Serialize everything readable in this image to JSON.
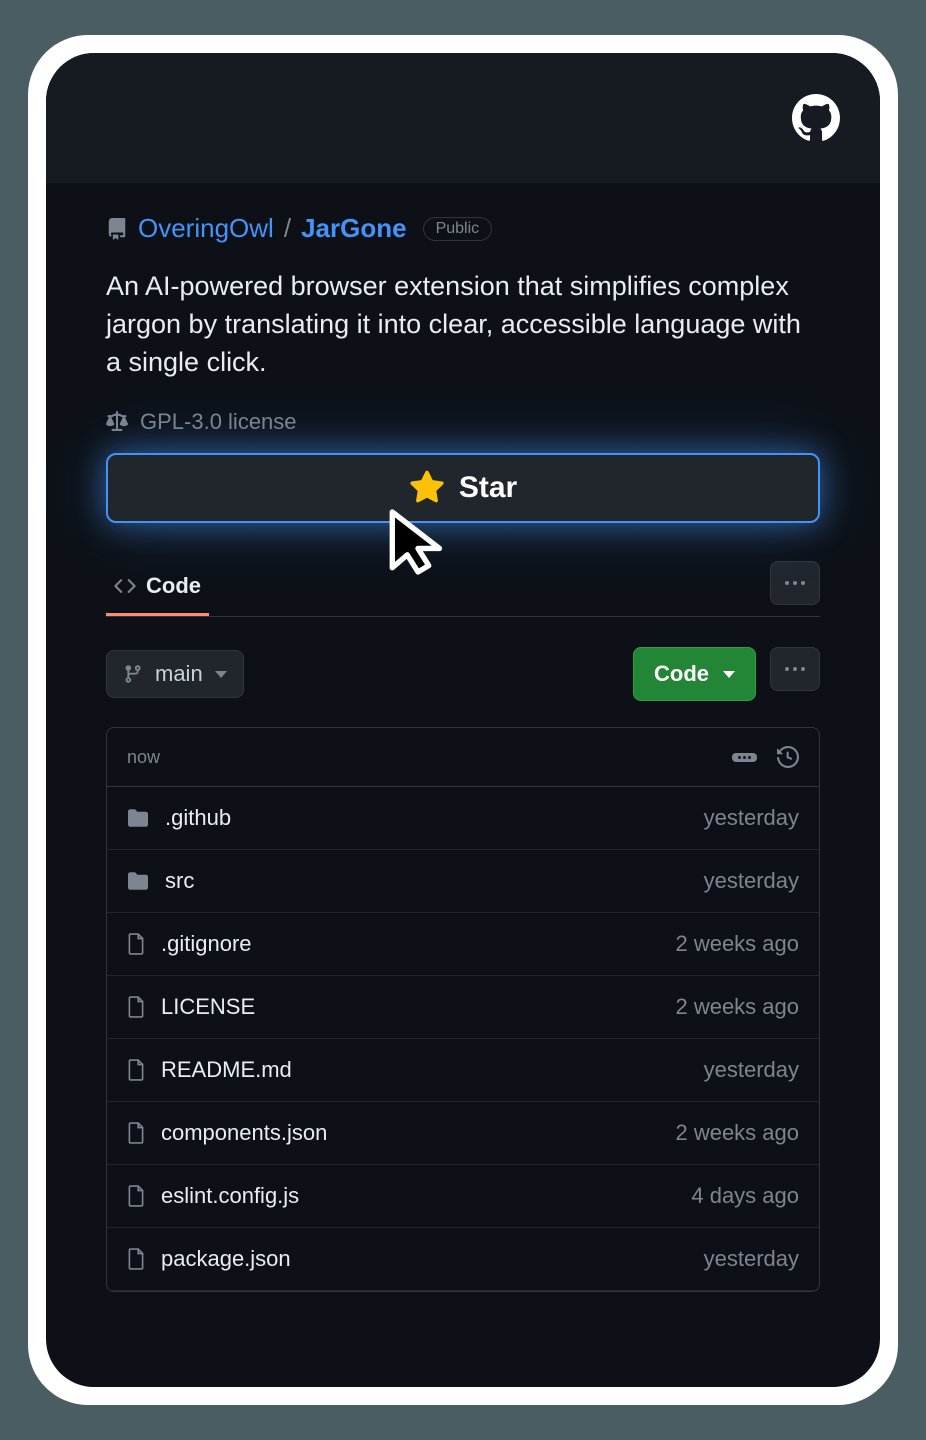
{
  "breadcrumb": {
    "owner": "OveringOwl",
    "repo": "JarGone",
    "separator": "/",
    "badge": "Public"
  },
  "description": "An AI-powered browser extension that simplifies complex jargon by translating it into clear, accessible language with a single click.",
  "license": "GPL-3.0 license",
  "star_button_label": "Star",
  "tabs": {
    "code": "Code"
  },
  "branch": {
    "name": "main"
  },
  "code_button": "Code",
  "list_header_time": "now",
  "files": [
    {
      "name": ".github",
      "type": "folder",
      "time": "yesterday"
    },
    {
      "name": "src",
      "type": "folder",
      "time": "yesterday"
    },
    {
      "name": ".gitignore",
      "type": "file",
      "time": "2 weeks ago"
    },
    {
      "name": "LICENSE",
      "type": "file",
      "time": "2 weeks ago"
    },
    {
      "name": "README.md",
      "type": "file",
      "time": "yesterday"
    },
    {
      "name": "components.json",
      "type": "file",
      "time": "2 weeks ago"
    },
    {
      "name": "eslint.config.js",
      "type": "file",
      "time": "4 days ago"
    },
    {
      "name": "package.json",
      "type": "file",
      "time": "yesterday"
    }
  ]
}
